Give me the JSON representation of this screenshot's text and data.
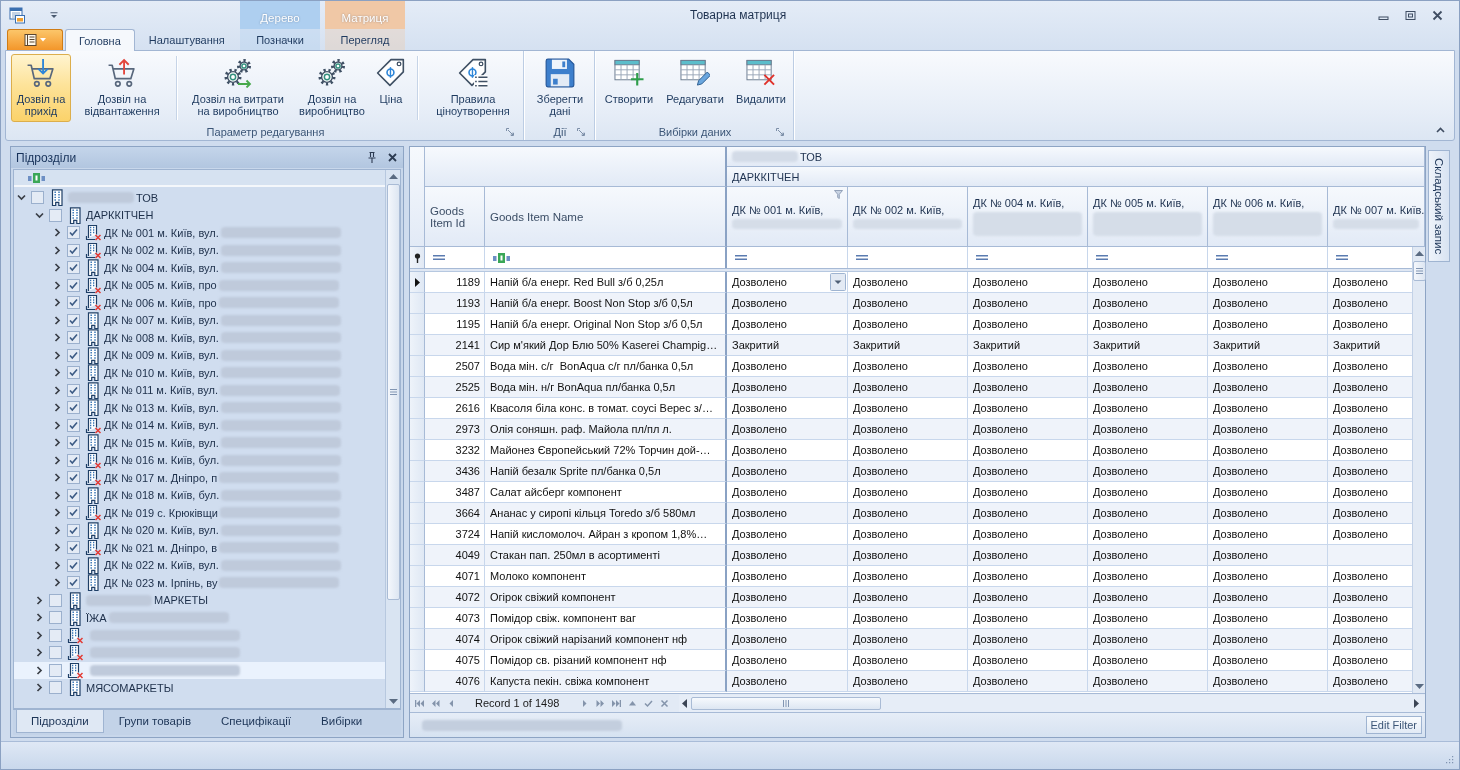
{
  "window": {
    "title": "Товарна матриця"
  },
  "ribbon": {
    "tabs": [
      {
        "label": "Головна",
        "selected": true
      },
      {
        "label": "Налаштування",
        "selected": false
      }
    ],
    "context_groups": [
      {
        "label": "Дерево",
        "color": "#aecff0",
        "tabs": [
          {
            "label": "Позначки",
            "selected": false
          }
        ]
      },
      {
        "label": "Матриця",
        "color": "#f0c8a6",
        "tabs": [
          {
            "label": "Перегляд",
            "selected": false
          }
        ]
      }
    ],
    "groups": [
      {
        "label": "Параметр редагування",
        "launcher": true,
        "sections": [
          {
            "buttons": [
              {
                "label": "Дозвіл на прихід",
                "kind": "receive",
                "selected": true
              },
              {
                "label": "Дозвіл на відвантаження",
                "kind": "ship",
                "selected": false
              }
            ]
          },
          {
            "buttons": [
              {
                "label": "Дозвіл на витрати на виробництво",
                "kind": "expense",
                "selected": false
              },
              {
                "label": "Дозвіл на виробництво",
                "kind": "production",
                "selected": false
              },
              {
                "label": "Ціна",
                "kind": "price",
                "selected": false
              }
            ]
          },
          {
            "buttons": [
              {
                "label": "Правила ціноутворення",
                "kind": "rules",
                "selected": false
              }
            ]
          }
        ]
      },
      {
        "label": "Дії",
        "launcher": true,
        "sections": [
          {
            "buttons": [
              {
                "label": "Зберегти дані",
                "kind": "save"
              }
            ]
          }
        ]
      },
      {
        "label": "Вибірки даних",
        "launcher": true,
        "sections": [
          {
            "buttons": [
              {
                "label": "Створити",
                "kind": "create"
              },
              {
                "label": "Редагувати",
                "kind": "edit"
              },
              {
                "label": "Видалити",
                "kind": "delete"
              }
            ]
          }
        ]
      }
    ]
  },
  "left_panel": {
    "title": "Підрозділи",
    "tree": [
      {
        "label": "ТОВ",
        "blur_before": true,
        "blur_after": false,
        "kind": "plain",
        "checked": false,
        "expanded": true,
        "selected": false,
        "children": [
          {
            "label": "ДАРККІТЧЕН",
            "blur_before": false,
            "blur_after": false,
            "kind": "plain",
            "checked": false,
            "expanded": true,
            "selected": false,
            "children": [
              {
                "label": "ДК № 001 м. Київ, вул.",
                "blur_before": false,
                "blur_after": true,
                "kind": "crossed",
                "checked": true,
                "expanded": false,
                "selected": false
              },
              {
                "label": "ДК № 002 м. Київ, вул.",
                "blur_before": false,
                "blur_after": true,
                "kind": "crossed",
                "checked": true,
                "expanded": false,
                "selected": false
              },
              {
                "label": "ДК № 004 м. Київ, вул.",
                "blur_before": false,
                "blur_after": true,
                "kind": "plain",
                "checked": true,
                "expanded": false,
                "selected": false
              },
              {
                "label": "ДК № 005 м. Київ, про",
                "blur_before": false,
                "blur_after": true,
                "kind": "crossed",
                "checked": true,
                "expanded": false,
                "selected": false
              },
              {
                "label": "ДК № 006 м. Київ, про",
                "blur_before": false,
                "blur_after": true,
                "kind": "crossed",
                "checked": true,
                "expanded": false,
                "selected": false
              },
              {
                "label": "ДК № 007 м. Київ, вул.",
                "blur_before": false,
                "blur_after": true,
                "kind": "plain",
                "checked": true,
                "expanded": false,
                "selected": false
              },
              {
                "label": "ДК № 008 м. Київ, вул.",
                "blur_before": false,
                "blur_after": true,
                "kind": "plain",
                "checked": true,
                "expanded": false,
                "selected": false
              },
              {
                "label": "ДК № 009 м. Київ, вул.",
                "blur_before": false,
                "blur_after": true,
                "kind": "plain",
                "checked": true,
                "expanded": false,
                "selected": false
              },
              {
                "label": "ДК № 010 м. Київ, вул.",
                "blur_before": false,
                "blur_after": true,
                "kind": "plain",
                "checked": true,
                "expanded": false,
                "selected": false
              },
              {
                "label": "ДК № 011 м. Київ, вул.",
                "blur_before": false,
                "blur_after": true,
                "kind": "plain",
                "checked": true,
                "expanded": false,
                "selected": false
              },
              {
                "label": "ДК № 013 м. Київ, вул.",
                "blur_before": false,
                "blur_after": true,
                "kind": "plain",
                "checked": true,
                "expanded": false,
                "selected": false
              },
              {
                "label": "ДК № 014 м. Київ, вул.",
                "blur_before": false,
                "blur_after": true,
                "kind": "crossed",
                "checked": true,
                "expanded": false,
                "selected": false
              },
              {
                "label": "ДК № 015 м. Київ, вул.",
                "blur_before": false,
                "blur_after": true,
                "kind": "plain",
                "checked": true,
                "expanded": false,
                "selected": false
              },
              {
                "label": "ДК № 016 м. Київ, бул.",
                "blur_before": false,
                "blur_after": true,
                "kind": "crossed",
                "checked": true,
                "expanded": false,
                "selected": false
              },
              {
                "label": "ДК № 017 м. Дніпро, п",
                "blur_before": false,
                "blur_after": true,
                "kind": "crossed",
                "checked": true,
                "expanded": false,
                "selected": false
              },
              {
                "label": "ДК № 018 м. Київ, бул.",
                "blur_before": false,
                "blur_after": true,
                "kind": "plain",
                "checked": true,
                "expanded": false,
                "selected": false
              },
              {
                "label": "ДК № 019 с. Крюківщи",
                "blur_before": false,
                "blur_after": true,
                "kind": "crossed",
                "checked": true,
                "expanded": false,
                "selected": false
              },
              {
                "label": "ДК № 020 м. Київ, вул.",
                "blur_before": false,
                "blur_after": true,
                "kind": "plain",
                "checked": true,
                "expanded": false,
                "selected": false
              },
              {
                "label": "ДК № 021 м. Дніпро, в",
                "blur_before": false,
                "blur_after": true,
                "kind": "crossed",
                "checked": true,
                "expanded": false,
                "selected": false
              },
              {
                "label": "ДК № 022 м. Київ, вул.",
                "blur_before": false,
                "blur_after": true,
                "kind": "plain",
                "checked": true,
                "expanded": false,
                "selected": false
              },
              {
                "label": "ДК № 023 м. Ірпінь, ву",
                "blur_before": false,
                "blur_after": true,
                "kind": "plain",
                "checked": true,
                "expanded": false,
                "selected": false
              }
            ]
          },
          {
            "label": "МАРКЕТЫ",
            "blur_before": true,
            "blur_after": false,
            "kind": "plain",
            "checked": false,
            "expanded": false,
            "selected": false
          },
          {
            "label": "ЇЖА",
            "blur_before": false,
            "blur_after": true,
            "kind": "plain",
            "checked": false,
            "expanded": false,
            "selected": false
          },
          {
            "blur_before": false,
            "blur_after": true,
            "kind": "crossed",
            "checked": false,
            "expanded": false,
            "selected": false
          },
          {
            "blur_before": false,
            "blur_after": true,
            "kind": "crossed",
            "checked": false,
            "expanded": false,
            "selected": false
          },
          {
            "blur_before": false,
            "blur_after": true,
            "kind": "crossed",
            "checked": false,
            "expanded": false,
            "selected": true
          },
          {
            "label": "МЯСОМАРКЕТЫ",
            "blur_before": false,
            "blur_after": false,
            "kind": "plain",
            "checked": false,
            "expanded": false,
            "selected": false
          }
        ]
      }
    ],
    "tabs": [
      {
        "label": "Підрозділи",
        "selected": true
      },
      {
        "label": "Групи товарів",
        "selected": false
      },
      {
        "label": "Специфікації",
        "selected": false
      },
      {
        "label": "Вибірки",
        "selected": false
      }
    ]
  },
  "grid": {
    "bands": [
      {
        "label": "ТОВ",
        "blur_before": true
      },
      {
        "label": "ДАРККІТЧЕН",
        "blur_before": false
      }
    ],
    "columns": [
      {
        "label": "Goods Item Id",
        "kind": "id"
      },
      {
        "label": "Goods Item Name",
        "kind": "name"
      },
      {
        "label": "ДК № 001 м. Київ,",
        "kind": "store",
        "blur_tall": false,
        "filter_icon": true
      },
      {
        "label": "ДК № 002 м. Київ,",
        "kind": "store",
        "blur_tall": false,
        "filter_icon": false
      },
      {
        "label": "ДК № 004 м. Київ,",
        "kind": "store",
        "blur_tall": true,
        "filter_icon": false
      },
      {
        "label": "ДК № 005 м. Київ,",
        "kind": "store",
        "blur_tall": true,
        "filter_icon": false
      },
      {
        "label": "ДК № 006 м. Київ,",
        "kind": "store",
        "blur_tall": true,
        "filter_icon": false
      },
      {
        "label": "ДК № 007 м. Київ.",
        "kind": "store",
        "blur_tall": false,
        "filter_icon": false
      }
    ],
    "rows": [
      {
        "selected": true,
        "cells": [
          "1189",
          "Напій б/а енерг. Red Bull з/б 0,25л",
          "Дозволено",
          "Дозволено",
          "Дозволено",
          "Дозволено",
          "Дозволено",
          "Дозволено"
        ]
      },
      {
        "selected": false,
        "cells": [
          "1193",
          "Напій б/а енерг. Boost Non Stop з/б 0,5л",
          "Дозволено",
          "Дозволено",
          "Дозволено",
          "Дозволено",
          "Дозволено",
          "Дозволено"
        ]
      },
      {
        "selected": false,
        "cells": [
          "1195",
          "Напій б/а енерг. Original Non Stop з/б 0,5л",
          "Дозволено",
          "Дозволено",
          "Дозволено",
          "Дозволено",
          "Дозволено",
          "Дозволено"
        ]
      },
      {
        "selected": false,
        "cells": [
          "2141",
          "Сир м'який Дор Блю 50% Kaserei Champig…",
          "Закритий",
          "Закритий",
          "Закритий",
          "Закритий",
          "Закритий",
          "Закритий"
        ]
      },
      {
        "selected": false,
        "cells": [
          "2507",
          "Вода мін. с/г  BonAqua с/г пл/банка 0,5л",
          "Дозволено",
          "Дозволено",
          "Дозволено",
          "Дозволено",
          "Дозволено",
          "Дозволено"
        ]
      },
      {
        "selected": false,
        "cells": [
          "2525",
          "Вода мін. н/г BonAqua пл/банка 0,5л",
          "Дозволено",
          "Дозволено",
          "Дозволено",
          "Дозволено",
          "Дозволено",
          "Дозволено"
        ]
      },
      {
        "selected": false,
        "cells": [
          "2616",
          "Квасоля біла конс. в томат. соусі Верес з/…",
          "Дозволено",
          "Дозволено",
          "Дозволено",
          "Дозволено",
          "Дозволено",
          "Дозволено"
        ]
      },
      {
        "selected": false,
        "cells": [
          "2973",
          "Олія соняшн. раф. Майола пл/пл л.",
          "Дозволено",
          "Дозволено",
          "Дозволено",
          "Дозволено",
          "Дозволено",
          "Дозволено"
        ]
      },
      {
        "selected": false,
        "cells": [
          "3232",
          "Майонез Європейський 72% Торчин дой-…",
          "Дозволено",
          "Дозволено",
          "Дозволено",
          "Дозволено",
          "Дозволено",
          "Дозволено"
        ]
      },
      {
        "selected": false,
        "cells": [
          "3436",
          "Напій безалк Sprite пл/банка 0,5л",
          "Дозволено",
          "Дозволено",
          "Дозволено",
          "Дозволено",
          "Дозволено",
          "Дозволено"
        ]
      },
      {
        "selected": false,
        "cells": [
          "3487",
          "Салат айсберг компонент",
          "Дозволено",
          "Дозволено",
          "Дозволено",
          "Дозволено",
          "Дозволено",
          "Дозволено"
        ]
      },
      {
        "selected": false,
        "cells": [
          "3664",
          "Ананас у сиропі кільця Toredo з/б 580мл",
          "Дозволено",
          "Дозволено",
          "Дозволено",
          "Дозволено",
          "Дозволено",
          "Дозволено"
        ]
      },
      {
        "selected": false,
        "cells": [
          "3724",
          "Напій кисломолоч. Айран з кропом 1,8%…",
          "Дозволено",
          "Дозволено",
          "Дозволено",
          "Дозволено",
          "Дозволено",
          "Дозволено"
        ]
      },
      {
        "selected": false,
        "cells": [
          "4049",
          "Стакан пап. 250мл в асортименті",
          "Дозволено",
          "Дозволено",
          "Дозволено",
          "Дозволено",
          "Дозволено"
        ]
      },
      {
        "selected": false,
        "cells": [
          "4071",
          "Молоко компонент",
          "Дозволено",
          "Дозволено",
          "Дозволено",
          "Дозволено",
          "Дозволено",
          "Дозволено"
        ]
      },
      {
        "selected": false,
        "cells": [
          "4072",
          "Огірок свіжий компонент",
          "Дозволено",
          "Дозволено",
          "Дозволено",
          "Дозволено",
          "Дозволено",
          "Дозволено"
        ]
      },
      {
        "selected": false,
        "cells": [
          "4073",
          "Помідор свіж. компонент ваг",
          "Дозволено",
          "Дозволено",
          "Дозволено",
          "Дозволено",
          "Дозволено",
          "Дозволено"
        ]
      },
      {
        "selected": false,
        "cells": [
          "4074",
          "Огірок свіжий нарізаний компонент нф",
          "Дозволено",
          "Дозволено",
          "Дозволено",
          "Дозволено",
          "Дозволено",
          "Дозволено"
        ]
      },
      {
        "selected": false,
        "cells": [
          "4075",
          "Помідор св. різаний компонент нф",
          "Дозволено",
          "Дозволено",
          "Дозволено",
          "Дозволено",
          "Дозволено",
          "Дозволено"
        ]
      },
      {
        "selected": false,
        "cells": [
          "4076",
          "Капуста пекін. свіжа компонент",
          "Дозволено",
          "Дозволено",
          "Дозволено",
          "Дозволено",
          "Дозволено",
          "Дозволено"
        ]
      }
    ],
    "navigator": {
      "record": "Record 1 of 1498"
    },
    "filter_panel": {
      "blurred": true,
      "button": "Edit Filter"
    }
  },
  "right_dock": {
    "tabs": [
      {
        "label": "Складський запис"
      }
    ]
  }
}
